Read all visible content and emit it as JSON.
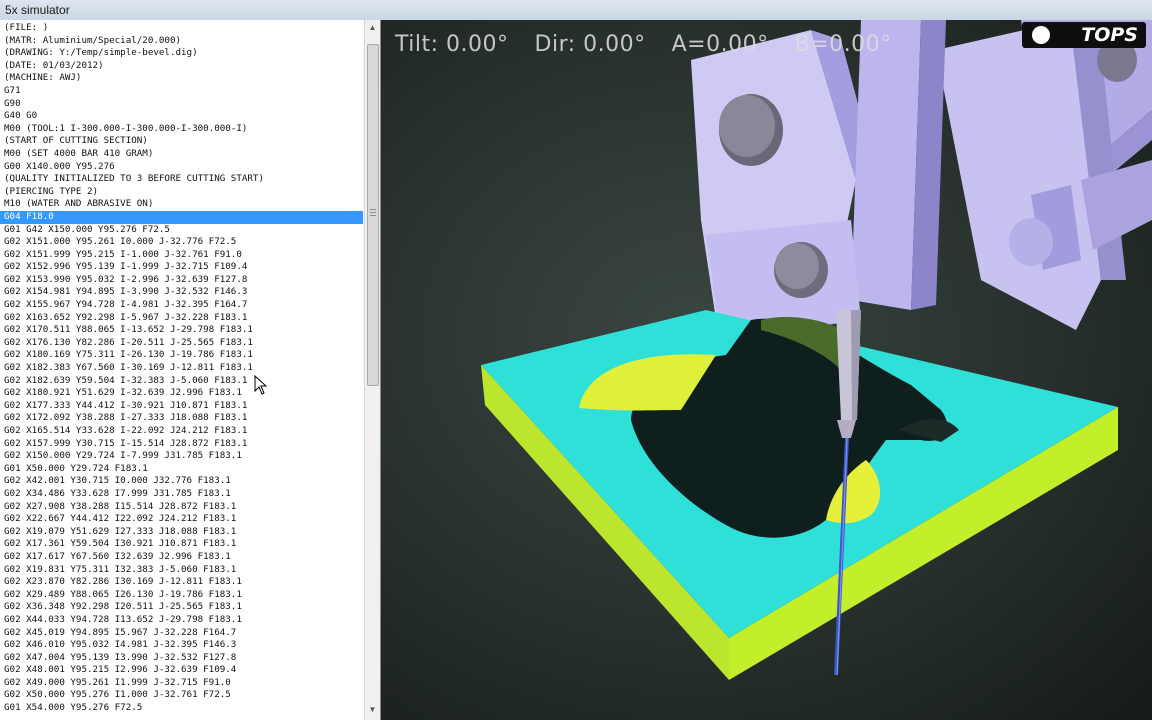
{
  "window": {
    "title": "5x simulator"
  },
  "hud": {
    "tilt": "Tilt: 0.00°",
    "dir": "Dir: 0.00°",
    "a": "A=0.00°",
    "b": "B=0.00°"
  },
  "brand": {
    "logo": "TOPS"
  },
  "code": {
    "selected_index": 17,
    "lines": [
      "(FILE: )",
      "(MATR: Aluminium/Special/20.000)",
      "(DRAWING: Y:/Temp/simple-bevel.dig)",
      "(DATE: 01/03/2012)",
      "(MACHINE: AWJ)",
      "G71",
      "G90",
      "G40 G0",
      "M00 (TOOL:1 I-300.000-I-300.000-I-300.000-I)",
      "(START OF CUTTING SECTION)",
      "M00 (SET 4000 BAR 410 GRAM)",
      "G00 X140.000 Y95.276",
      "(QUALITY INITIALIZED TO 3 BEFORE CUTTING START)",
      "(PIERCING TYPE 2)",
      "M10 (WATER AND ABRASIVE ON)",
      "G04 F18.0",
      "G01 G42 X150.000 Y95.276 F72.5",
      "G02 X151.000 Y95.261 I0.000 J-32.776 F72.5",
      "G02 X151.999 Y95.215 I-1.000 J-32.761 F91.0",
      "G02 X152.996 Y95.139 I-1.999 J-32.715 F109.4",
      "G02 X153.990 Y95.032 I-2.996 J-32.639 F127.8",
      "G02 X154.981 Y94.895 I-3.990 J-32.532 F146.3",
      "G02 X155.967 Y94.728 I-4.981 J-32.395 F164.7",
      "G02 X163.652 Y92.298 I-5.967 J-32.228 F183.1",
      "G02 X170.511 Y88.065 I-13.652 J-29.798 F183.1",
      "G02 X176.130 Y82.286 I-20.511 J-25.565 F183.1",
      "G02 X180.169 Y75.311 I-26.130 J-19.786 F183.1",
      "G02 X182.383 Y67.560 I-30.169 J-12.811 F183.1",
      "G02 X182.639 Y59.504 I-32.383 J-5.060 F183.1",
      "G02 X180.921 Y51.629 I-32.639 J2.996 F183.1",
      "G02 X177.333 Y44.412 I-30.921 J10.871 F183.1",
      "G02 X172.092 Y38.288 I-27.333 J18.088 F183.1",
      "G02 X165.514 Y33.628 I-22.092 J24.212 F183.1",
      "G02 X157.999 Y30.715 I-15.514 J28.872 F183.1",
      "G02 X150.000 Y29.724 I-7.999 J31.785 F183.1",
      "G01 X50.000 Y29.724 F183.1",
      "G02 X42.001 Y30.715 I0.000 J32.776 F183.1",
      "G02 X34.486 Y33.628 I7.999 J31.785 F183.1",
      "G02 X27.908 Y38.288 I15.514 J28.872 F183.1",
      "G02 X22.667 Y44.412 I22.092 J24.212 F183.1",
      "G02 X19.079 Y51.629 I27.333 J18.088 F183.1",
      "G02 X17.361 Y59.504 I30.921 J10.871 F183.1",
      "G02 X17.617 Y67.560 I32.639 J2.996 F183.1",
      "G02 X19.831 Y75.311 I32.383 J-5.060 F183.1",
      "G02 X23.870 Y82.286 I30.169 J-12.811 F183.1",
      "G02 X29.489 Y88.065 I26.130 J-19.786 F183.1",
      "G02 X36.348 Y92.298 I20.511 J-25.565 F183.1",
      "G02 X44.033 Y94.728 I13.652 J-29.798 F183.1",
      "G02 X45.019 Y94.895 I5.967 J-32.228 F164.7",
      "G02 X46.010 Y95.032 I4.981 J-32.395 F146.3",
      "G02 X47.004 Y95.139 I3.990 J-32.532 F127.8",
      "G02 X48.001 Y95.215 I2.996 J-32.639 F109.4",
      "G02 X49.000 Y95.261 I1.999 J-32.715 F91.0",
      "G02 X50.000 Y95.276 I1.000 J-32.761 F72.5",
      "G01 X54.000 Y95.276 F72.5"
    ]
  }
}
